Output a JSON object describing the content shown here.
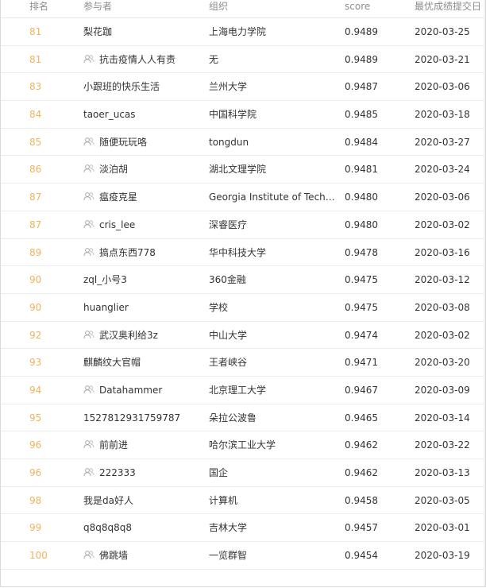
{
  "header": {
    "rank": "排名",
    "participant": "参与者",
    "org": "组织",
    "score": "score",
    "date": "最优成绩提交日"
  },
  "rows": [
    {
      "rank": "81",
      "name": "梨花跏",
      "team": false,
      "org": "上海电力学院",
      "score": "0.9489",
      "date": "2020-03-25"
    },
    {
      "rank": "81",
      "name": "抗击疫情人人有责",
      "team": true,
      "org": "无",
      "score": "0.9489",
      "date": "2020-03-21"
    },
    {
      "rank": "83",
      "name": "小跟班的快乐生活",
      "team": false,
      "org": "兰州大学",
      "score": "0.9487",
      "date": "2020-03-06"
    },
    {
      "rank": "84",
      "name": "taoer_ucas",
      "team": false,
      "org": "中国科学院",
      "score": "0.9485",
      "date": "2020-03-18"
    },
    {
      "rank": "85",
      "name": "随便玩玩咯",
      "team": true,
      "org": "tongdun",
      "score": "0.9484",
      "date": "2020-03-27"
    },
    {
      "rank": "86",
      "name": "淡泊胡",
      "team": true,
      "org": "湖北文理学院",
      "score": "0.9481",
      "date": "2020-03-24"
    },
    {
      "rank": "87",
      "name": "瘟疫克星",
      "team": true,
      "org": "Georgia Institute of Technology",
      "score": "0.9480",
      "date": "2020-03-06"
    },
    {
      "rank": "87",
      "name": "cris_lee",
      "team": true,
      "org": "深睿医疗",
      "score": "0.9480",
      "date": "2020-03-02"
    },
    {
      "rank": "89",
      "name": "搞点东西778",
      "team": true,
      "org": "华中科技大学",
      "score": "0.9478",
      "date": "2020-03-16"
    },
    {
      "rank": "90",
      "name": "zql_小号3",
      "team": false,
      "org": "360金融",
      "score": "0.9475",
      "date": "2020-03-12"
    },
    {
      "rank": "90",
      "name": "huanglier",
      "team": false,
      "org": "学校",
      "score": "0.9475",
      "date": "2020-03-08"
    },
    {
      "rank": "92",
      "name": "武汉奥利给3z",
      "team": true,
      "org": "中山大学",
      "score": "0.9474",
      "date": "2020-03-02"
    },
    {
      "rank": "93",
      "name": "麒麟纹大官帽",
      "team": false,
      "org": "王者峡谷",
      "score": "0.9471",
      "date": "2020-03-20"
    },
    {
      "rank": "94",
      "name": "Datahammer",
      "team": true,
      "org": "北京理工大学",
      "score": "0.9467",
      "date": "2020-03-09"
    },
    {
      "rank": "95",
      "name": "1527812931759787",
      "team": false,
      "org": "朵拉公波鲁",
      "score": "0.9465",
      "date": "2020-03-14"
    },
    {
      "rank": "96",
      "name": "前前进",
      "team": true,
      "org": "哈尔滨工业大学",
      "score": "0.9462",
      "date": "2020-03-22"
    },
    {
      "rank": "96",
      "name": "222333",
      "team": true,
      "org": "国企",
      "score": "0.9462",
      "date": "2020-03-13"
    },
    {
      "rank": "98",
      "name": "我是da好人",
      "team": false,
      "org": "计算机",
      "score": "0.9458",
      "date": "2020-03-05"
    },
    {
      "rank": "99",
      "name": "q8q8q8q8",
      "team": false,
      "org": "吉林大学",
      "score": "0.9457",
      "date": "2020-03-01"
    },
    {
      "rank": "100",
      "name": "佛跳墙",
      "team": true,
      "org": "一览群智",
      "score": "0.9454",
      "date": "2020-03-19"
    }
  ],
  "colors": {
    "rank": "#f0b25f",
    "header_text": "#8c8c8c",
    "body_text": "#333333",
    "row_border": "#ececec"
  },
  "icons": {
    "team": "team-icon"
  }
}
